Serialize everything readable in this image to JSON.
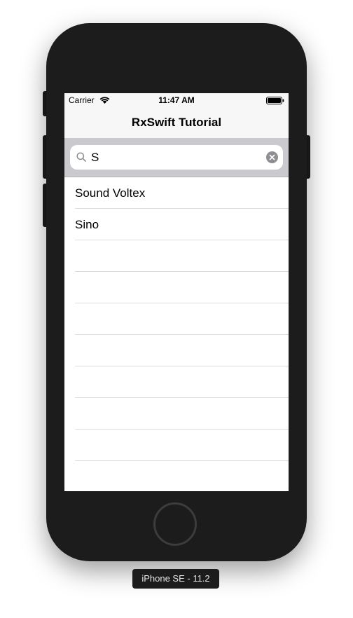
{
  "device": {
    "label": "iPhone SE - 11.2"
  },
  "status_bar": {
    "carrier": "Carrier",
    "time": "11:47 AM"
  },
  "nav": {
    "title": "RxSwift Tutorial"
  },
  "search": {
    "value": "S"
  },
  "table": {
    "rows": [
      {
        "label": "Sound Voltex"
      },
      {
        "label": "Sino"
      },
      {
        "label": ""
      },
      {
        "label": ""
      },
      {
        "label": ""
      },
      {
        "label": ""
      },
      {
        "label": ""
      },
      {
        "label": ""
      },
      {
        "label": ""
      }
    ]
  },
  "colors": {
    "device_body": "#1c1c1c",
    "search_bar_bg": "#c9c9ce",
    "nav_bg": "#f7f7f7"
  }
}
